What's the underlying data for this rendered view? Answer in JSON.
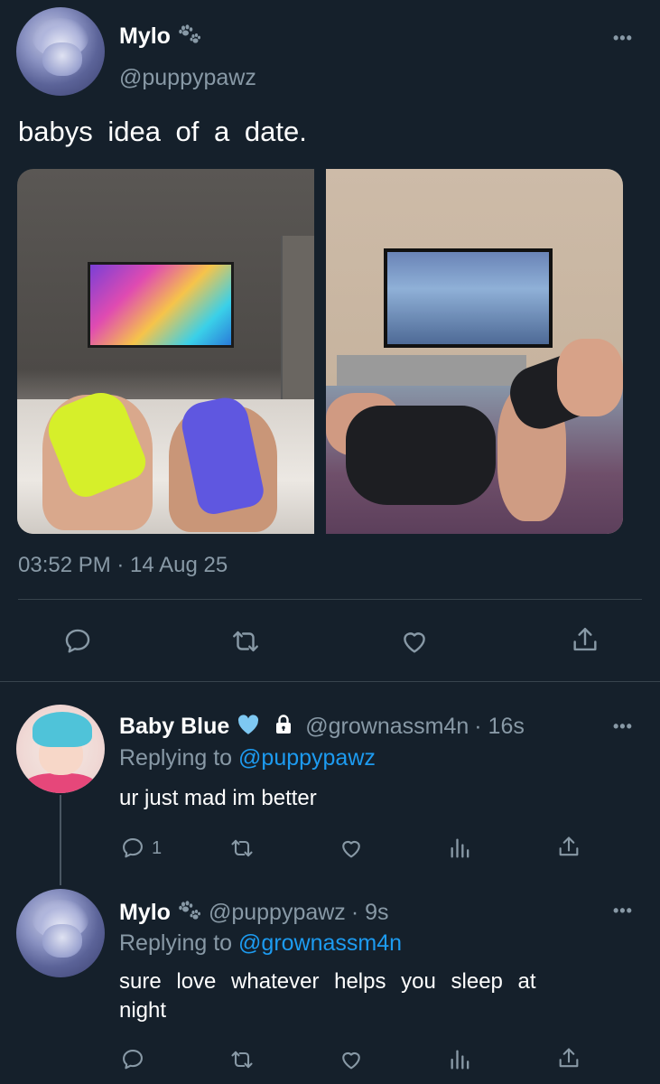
{
  "main_tweet": {
    "author": {
      "name": "Mylo",
      "handle": "@puppypawz",
      "name_badge_icon": "paw-prints-icon"
    },
    "text": "babys idea of a date.",
    "timestamp": "03:52 PM · 14 Aug 25",
    "media": [
      {
        "alt": "hands holding yellow and blue Nintendo Switch Joy-Cons in front of a TV showing Mario Kart 8 Deluxe"
      },
      {
        "alt": "hands holding PlayStation controllers in front of a TV"
      }
    ],
    "actions": [
      "reply-icon",
      "retweet-icon",
      "like-icon",
      "share-icon"
    ]
  },
  "replies": [
    {
      "author": {
        "name": "Baby Blue",
        "handle": "@grownassm4n",
        "time": "· 16s"
      },
      "replying_to_label": "Replying to",
      "replying_to_handle": "@puppypawz",
      "text": "ur just mad im better",
      "reply_count": "1"
    },
    {
      "author": {
        "name": "Mylo",
        "handle": "@puppypawz",
        "time": "· 9s"
      },
      "replying_to_label": "Replying to",
      "replying_to_handle": "@grownassm4n",
      "text": "sure love whatever helps you sleep at night",
      "reply_count": ""
    }
  ],
  "more_label": "•••",
  "colors": {
    "background": "#15202b",
    "muted": "#8899a6",
    "link": "#1d9bf0",
    "divider": "#38444d",
    "heart": "#7ec8f2"
  }
}
